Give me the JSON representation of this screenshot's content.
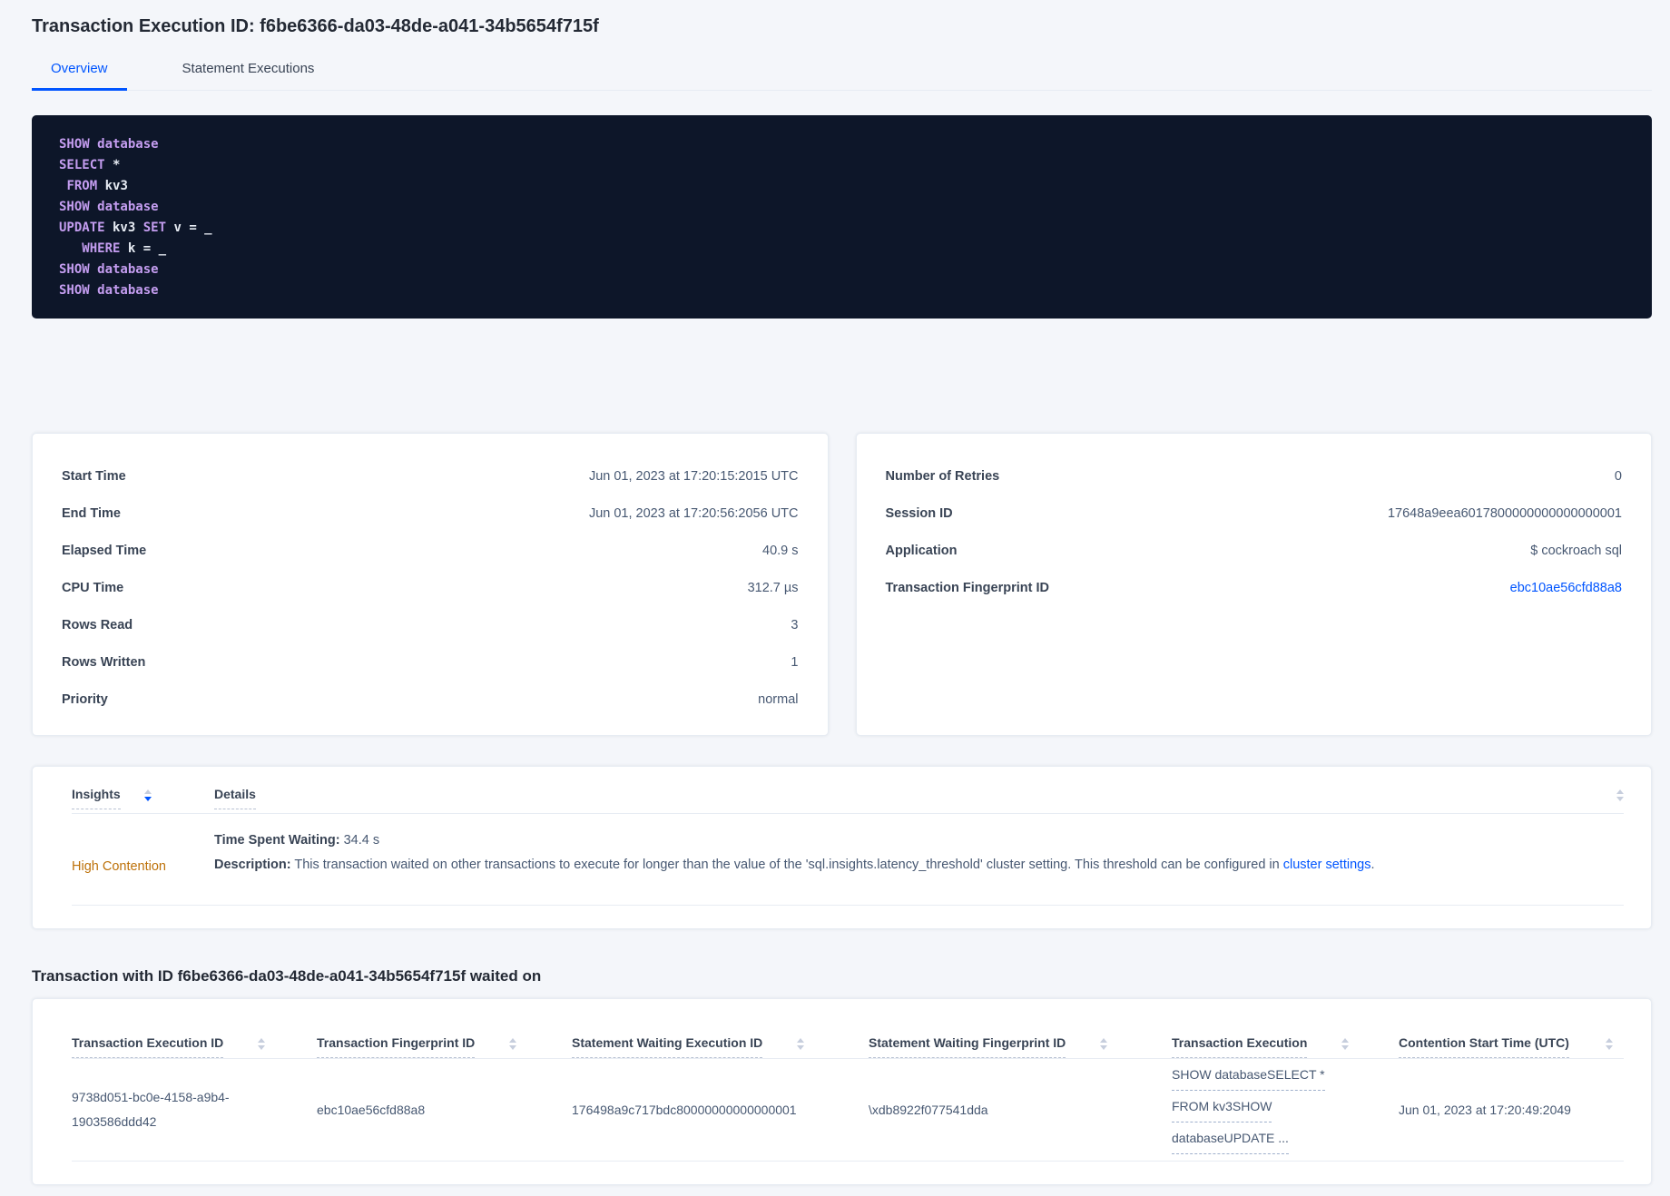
{
  "page": {
    "title": "Transaction Execution ID: f6be6366-da03-48de-a041-34b5654f715f"
  },
  "tabs": [
    {
      "label": "Overview",
      "active": true
    },
    {
      "label": "Statement Executions",
      "active": false
    }
  ],
  "sql_box": {
    "lines": [
      [
        {
          "text": "SHOW database",
          "kw": true
        }
      ],
      [
        {
          "text": "SELECT",
          "kw": true
        },
        {
          "text": " *",
          "kw": false
        }
      ],
      [
        {
          "text": " ",
          "kw": false
        },
        {
          "text": "FROM",
          "kw": true
        },
        {
          "text": " kv3",
          "kw": false
        }
      ],
      [
        {
          "text": "SHOW database",
          "kw": true
        }
      ],
      [
        {
          "text": "UPDATE",
          "kw": true
        },
        {
          "text": " kv3 ",
          "kw": false
        },
        {
          "text": "SET",
          "kw": true
        },
        {
          "text": " v = _",
          "kw": false
        }
      ],
      [
        {
          "text": "   ",
          "kw": false
        },
        {
          "text": "WHERE",
          "kw": true
        },
        {
          "text": " k = _",
          "kw": false
        }
      ],
      [
        {
          "text": "SHOW database",
          "kw": true
        }
      ],
      [
        {
          "text": "SHOW database",
          "kw": true
        }
      ]
    ]
  },
  "left_card": {
    "rows": [
      {
        "label": "Start Time",
        "value": "Jun 01, 2023 at 17:20:15:2015 UTC"
      },
      {
        "label": "End Time",
        "value": "Jun 01, 2023 at 17:20:56:2056 UTC"
      },
      {
        "label": "Elapsed Time",
        "value": "40.9 s"
      },
      {
        "label": "CPU Time",
        "value": "312.7 µs"
      },
      {
        "label": "Rows Read",
        "value": "3"
      },
      {
        "label": "Rows Written",
        "value": "1"
      },
      {
        "label": "Priority",
        "value": "normal"
      }
    ]
  },
  "right_card": {
    "rows": [
      {
        "label": "Number of Retries",
        "value": "0"
      },
      {
        "label": "Session ID",
        "value": "17648a9eea6017800000000000000001"
      },
      {
        "label": "Application",
        "value": "$ cockroach sql"
      },
      {
        "label": "Transaction Fingerprint ID",
        "value": "ebc10ae56cfd88a8"
      }
    ]
  },
  "insights_table": {
    "headers": [
      {
        "label": "Insights"
      },
      {
        "label": "Details"
      }
    ],
    "row": {
      "insight": "High Contention",
      "waiting_label": "Time Spent Waiting:",
      "waiting_value": " 34.4 s",
      "description_label": "Description:",
      "description_text": " This transaction waited on other transactions to execute for longer than the value of the 'sql.insights.latency_threshold' cluster setting. This threshold can be configured in ",
      "description_link": "cluster settings",
      "description_suffix": "."
    }
  },
  "waited_section": {
    "heading": "Transaction with ID f6be6366-da03-48de-a041-34b5654f715f waited on",
    "columns": [
      "Transaction Execution ID",
      "Transaction Fingerprint ID",
      "Statement Waiting Execution ID",
      "Statement Waiting Fingerprint ID",
      "Transaction Execution",
      "Contention Start Time (UTC)"
    ],
    "rows": [
      {
        "transaction_execution_id": "9738d051-bc0e-4158-a9b4-1903586ddd42",
        "transaction_fingerprint_id": "ebc10ae56cfd88a8",
        "statement_waiting_execution_id": "176498a9c717bdc80000000000000001",
        "statement_waiting_fingerprint_id": "\\xdb8922f077541dda",
        "transaction_execution_lines": [
          "SHOW databaseSELECT *",
          "FROM kv3SHOW",
          "databaseUPDATE ..."
        ],
        "contention_start_time": "Jun 01, 2023 at 17:20:49:2049"
      }
    ]
  },
  "colors": {
    "accent_blue": "#0055ff",
    "insight_warning": "#bd7109",
    "code_background": "#0d1629",
    "code_keyword": "#c49df0",
    "page_background": "#f4f6fa"
  }
}
